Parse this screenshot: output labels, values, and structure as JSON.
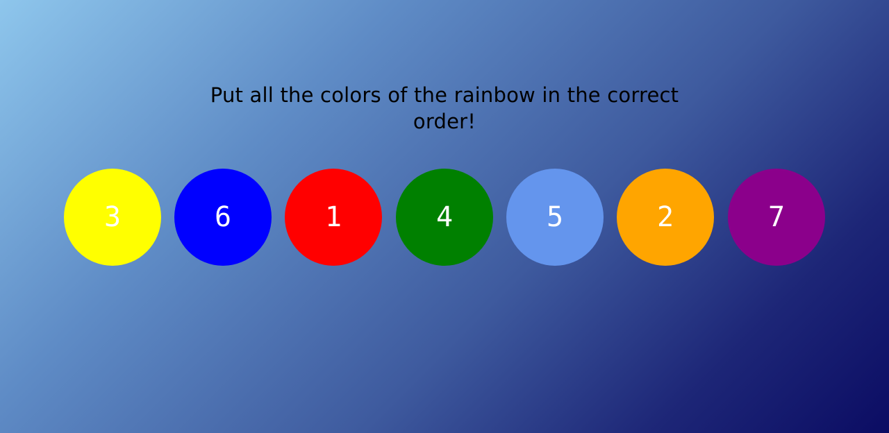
{
  "instruction": "Put all the colors of the rainbow in the correct order!",
  "circles": [
    {
      "number": "3",
      "color": "#ffff00"
    },
    {
      "number": "6",
      "color": "#0000ff"
    },
    {
      "number": "1",
      "color": "#ff0000"
    },
    {
      "number": "4",
      "color": "#008000"
    },
    {
      "number": "5",
      "color": "#6495ed"
    },
    {
      "number": "2",
      "color": "#ffa500"
    },
    {
      "number": "7",
      "color": "#8b008b"
    }
  ]
}
